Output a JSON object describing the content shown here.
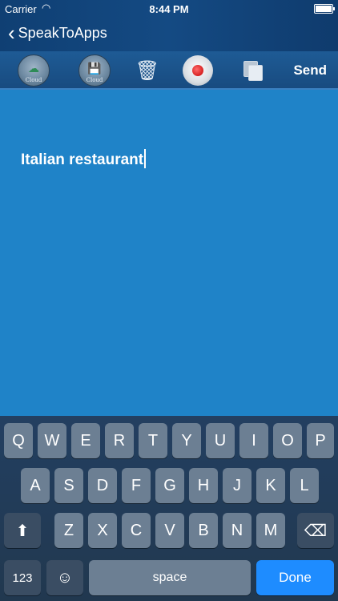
{
  "status_bar": {
    "carrier": "Carrier",
    "time": "8:44 PM"
  },
  "nav": {
    "back_label": "SpeakToApps"
  },
  "toolbar": {
    "cloud1_label": "Cloud",
    "cloud2_label": "Cloud",
    "send_label": "Send"
  },
  "editor": {
    "text": "Italian restaurant"
  },
  "keyboard": {
    "row1": [
      "Q",
      "W",
      "E",
      "R",
      "T",
      "Y",
      "U",
      "I",
      "O",
      "P"
    ],
    "row2": [
      "A",
      "S",
      "D",
      "F",
      "G",
      "H",
      "J",
      "K",
      "L"
    ],
    "row3": [
      "Z",
      "X",
      "C",
      "V",
      "B",
      "N",
      "M"
    ],
    "numbers_label": "123",
    "space_label": "space",
    "done_label": "Done"
  },
  "colors": {
    "editor_bg": "#1f83c8",
    "done_key": "#1e8cff"
  }
}
